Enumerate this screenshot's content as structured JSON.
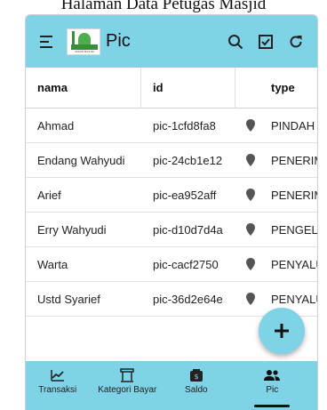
{
  "page_caption": "Halaman Data Petugas Masjid",
  "app": {
    "title": "Pic",
    "logo_text": "ADMIN MASJID"
  },
  "table": {
    "headers": [
      "nama",
      "id",
      "",
      "type"
    ],
    "rows": [
      {
        "nama": "Ahmad",
        "id": "pic-1cfd8fa8",
        "type": "PINDAH B"
      },
      {
        "nama": "Endang Wahyudi",
        "id": "pic-24cb1e12",
        "type": "PENERIMA"
      },
      {
        "nama": "Arief",
        "id": "pic-ea952aff",
        "type": "PENERIMA"
      },
      {
        "nama": "Erry Wahyudi",
        "id": "pic-d10d7d4a",
        "type": "PENGELUA"
      },
      {
        "nama": "Warta",
        "id": "pic-cacf2750",
        "type": "PENYALUR"
      },
      {
        "nama": "Ustd Syarief",
        "id": "pic-36d2e64e",
        "type": "PENYALUR"
      }
    ]
  },
  "bottom_nav": {
    "items": [
      {
        "label": "Transaksi",
        "icon": "chart-icon"
      },
      {
        "label": "Kategori Bayar",
        "icon": "category-icon"
      },
      {
        "label": "Saldo",
        "icon": "wallet-icon"
      },
      {
        "label": "Pic",
        "icon": "people-icon",
        "active": true
      }
    ]
  },
  "colors": {
    "accent": "#7ed3e6"
  }
}
